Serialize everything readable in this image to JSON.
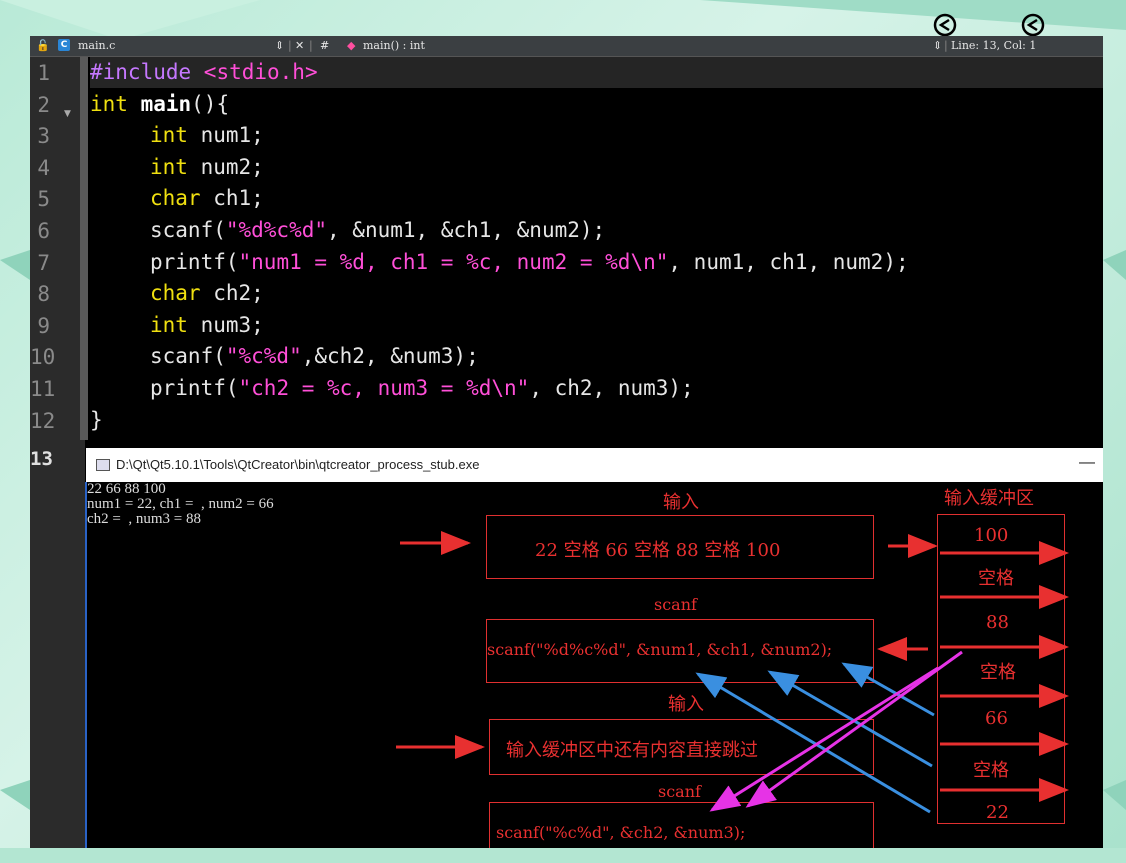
{
  "toolbar": {
    "file_name": "main.c",
    "file_icon": "C",
    "func_symbol": "main() : int",
    "hash": "#",
    "cursor": "Line: 13, Col: 1"
  },
  "line_numbers": [
    "1",
    "2",
    "3",
    "4",
    "5",
    "6",
    "7",
    "8",
    "9",
    "10",
    "11",
    "12"
  ],
  "current_line": "13",
  "code": {
    "l1a": "#include ",
    "l1b": "<stdio.h>",
    "l2a": "int ",
    "l2b": "main",
    "l2c": "(){",
    "l3a": "int",
    "l3b": " num1;",
    "l4a": "int",
    "l4b": " num2;",
    "l5a": "char",
    "l5b": " ch1;",
    "l6a": "scanf(",
    "l6b": "\"%d%c%d\"",
    "l6c": ", &num1, &ch1, &num2);",
    "l7a": "printf(",
    "l7b": "\"num1 = %d, ch1 = %c, num2 = %d\\n\"",
    "l7c": ", num1, ch1, num2);",
    "l8a": "char",
    "l8b": " ch2;",
    "l9a": "int",
    "l9b": " num3;",
    "l10a": "scanf(",
    "l10b": "\"%c%d\"",
    "l10c": ",&ch2, &num3);",
    "l11a": "printf(",
    "l11b": "\"ch2 = %c, num3 = %d\\n\"",
    "l11c": ", ch2, num3);",
    "l12": "}"
  },
  "console": {
    "title": "D:\\Qt\\Qt5.10.1\\Tools\\QtCreator\\bin\\qtcreator_process_stub.exe",
    "minimize": "—",
    "output": [
      "22 66 88 100",
      "num1 = 22, ch1 =  , num2 = 66",
      "ch2 =  , num3 = 88"
    ]
  },
  "diagram": {
    "label_input1": "输入",
    "box_input1": "22 空格 66 空格 88 空格 100",
    "label_scanf1": "scanf",
    "box_scanf1": "scanf(\"%d%c%d\", &num1, &ch1, &num2);",
    "label_input2": "输入",
    "box_input2": "输入缓冲区中还有内容直接跳过",
    "label_scanf2": "scanf",
    "box_scanf2": "scanf(\"%c%d\", &ch2, &num3);",
    "buffer_title": "输入缓冲区",
    "buffer_items": [
      "100",
      "空格",
      "88",
      "空格",
      "66",
      "空格",
      "22"
    ]
  },
  "colors": {
    "accent_red": "#e83030",
    "arrow_blue": "#3a8fe0",
    "arrow_magenta": "#e633e6"
  }
}
